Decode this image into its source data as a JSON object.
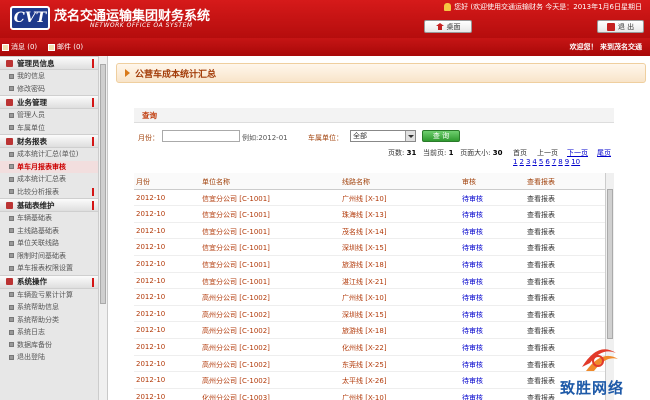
{
  "header": {
    "logo": "CVT",
    "title": "茂名交通运输集团财务系统",
    "subtitle": "NETWORK OFFICE OA SYSTEM",
    "info": "您好 (欢迎使用交通运输财务  今天是：2013年1月6日星期日",
    "desk_label": "桌面",
    "exit_label": "退 出"
  },
  "toolbar": {
    "messages": "消息 (0)",
    "mail": "邮件 (0)",
    "welcome": "欢迎您！ 来到茂名交通"
  },
  "sidebar": {
    "sections": [
      {
        "title": "管理员信息",
        "items": [
          "我的信息",
          "修改密码"
        ]
      },
      {
        "title": "业务管理",
        "items": [
          "管理人员",
          "车属单位"
        ]
      },
      {
        "title": "财务报表",
        "items": [
          "成本统计汇总(单位)",
          "单车月报表审核",
          "成本统计汇总表",
          "比较分析报表"
        ]
      },
      {
        "title": "基础表维护",
        "items": [
          "车辆基础表",
          "主线路基础表",
          "单位关联线路",
          "限制时间基础表",
          "单车报表权限设置"
        ]
      },
      {
        "title": "系统操作",
        "items": [
          "车辆盈亏累计计算",
          "系统帮助信息",
          "系统帮助分类",
          "系统日志",
          "数据库备份",
          "退出登陆"
        ]
      }
    ]
  },
  "main": {
    "title": "公营车成本统计汇总",
    "query_title": "查询",
    "month_label": "月份：",
    "month_value": "",
    "month_hint": "例如:2012-01",
    "unit_label": "车属单位：",
    "unit_value": "全部",
    "search_button": "查 询",
    "pager_text_pages": "页数: ",
    "pager_pages": "31",
    "pager_text_current": "当前页: ",
    "pager_current": "1",
    "pager_text_size": "页面大小: ",
    "pager_size": "30",
    "first": "首页",
    "prev": "上一页",
    "next": "下一页",
    "last": "尾页",
    "pages": [
      "1",
      "2",
      "3",
      "4",
      "5",
      "6",
      "7",
      "8",
      "9",
      "10"
    ],
    "columns": [
      "月份",
      "单位名称",
      "线路名称",
      "审核",
      "查看报表"
    ],
    "rows": [
      [
        "2012-10",
        "信宜分公司 [C-1001]",
        "广州线 [X-10]",
        "待审核",
        "查看报表"
      ],
      [
        "2012-10",
        "信宜分公司 [C-1001]",
        "珠海线 [X-13]",
        "待审核",
        "查看报表"
      ],
      [
        "2012-10",
        "信宜分公司 [C-1001]",
        "茂名线 [X-14]",
        "待审核",
        "查看报表"
      ],
      [
        "2012-10",
        "信宜分公司 [C-1001]",
        "深圳线 [X-15]",
        "待审核",
        "查看报表"
      ],
      [
        "2012-10",
        "信宜分公司 [C-1001]",
        "旅游线 [X-18]",
        "待审核",
        "查看报表"
      ],
      [
        "2012-10",
        "信宜分公司 [C-1001]",
        "湛江线 [X-21]",
        "待审核",
        "查看报表"
      ],
      [
        "2012-10",
        "高州分公司 [C-1002]",
        "广州线 [X-10]",
        "待审核",
        "查看报表"
      ],
      [
        "2012-10",
        "高州分公司 [C-1002]",
        "深圳线 [X-15]",
        "待审核",
        "查看报表"
      ],
      [
        "2012-10",
        "高州分公司 [C-1002]",
        "旅游线 [X-18]",
        "待审核",
        "查看报表"
      ],
      [
        "2012-10",
        "高州分公司 [C-1002]",
        "化州线 [X-22]",
        "待审核",
        "查看报表"
      ],
      [
        "2012-10",
        "高州分公司 [C-1002]",
        "东莞线 [X-25]",
        "待审核",
        "查看报表"
      ],
      [
        "2012-10",
        "高州分公司 [C-1002]",
        "太平线 [X-26]",
        "待审核",
        "查看报表"
      ],
      [
        "2012-10",
        "化州分公司 [C-1003]",
        "广州线 [X-10]",
        "待审核",
        "查看报表"
      ]
    ]
  },
  "watermark": "致胜网络",
  "colors": {
    "brand_red": "#c61515",
    "link_blue": "#0000cc",
    "accent_orange": "#a0400a"
  }
}
